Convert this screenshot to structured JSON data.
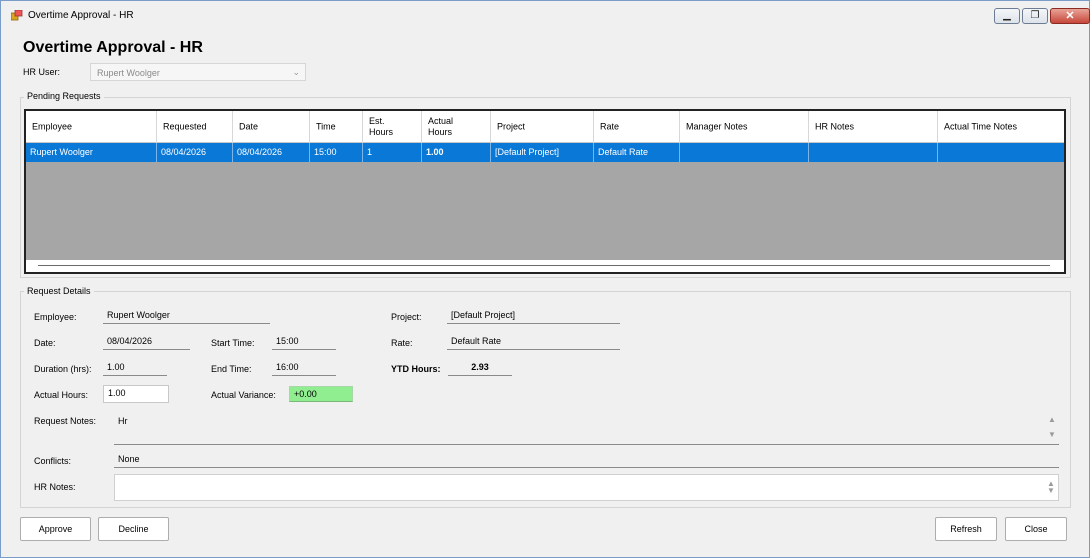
{
  "window": {
    "title": "Overtime Approval - HR",
    "min_glyph": "▁",
    "max_glyph": "❐",
    "close_glyph": "✕"
  },
  "page_title": "Overtime Approval - HR",
  "hr_user": {
    "label": "HR User:",
    "value": "Rupert Woolger",
    "chevron": "⌄"
  },
  "pending": {
    "group_title": "Pending Requests",
    "columns": [
      "Employee",
      "Requested",
      "Date",
      "Time",
      "Est.\nHours",
      "Actual\nHours",
      "Project",
      "Rate",
      "Manager Notes",
      "HR Notes",
      "Actual Time Notes"
    ],
    "rows": [
      [
        "Rupert Woolger",
        "08/04/2026",
        "08/04/2026",
        "15:00",
        "1",
        "1.00",
        "[Default Project]",
        "Default Rate",
        "",
        "",
        ""
      ]
    ]
  },
  "details": {
    "group_title": "Request Details",
    "employee_label": "Employee:",
    "employee_value": "Rupert Woolger",
    "project_label": "Project:",
    "project_value": "[Default Project]",
    "date_label": "Date:",
    "date_value": "08/04/2026",
    "start_label": "Start Time:",
    "start_value": "15:00",
    "rate_label": "Rate:",
    "rate_value": "Default Rate",
    "duration_label": "Duration (hrs):",
    "duration_value": "1.00",
    "end_label": "End Time:",
    "end_value": "16:00",
    "ytd_label": "YTD Hours:",
    "ytd_value": "2.93",
    "actual_hours_label": "Actual Hours:",
    "actual_hours_value": "1.00",
    "variance_label": "Actual Variance:",
    "variance_value": "+0.00",
    "request_notes_label": "Request Notes:",
    "request_notes_value": "Hr",
    "conflicts_label": "Conflicts:",
    "conflicts_value": "None",
    "hr_notes_label": "HR Notes:",
    "hr_notes_value": ""
  },
  "buttons": {
    "approve": "Approve",
    "decline": "Decline",
    "refresh": "Refresh",
    "close": "Close"
  },
  "colors": {
    "selection": "#0a78d7",
    "variance_ok": "#90ee90",
    "grid_empty": "#a6a6a6"
  }
}
